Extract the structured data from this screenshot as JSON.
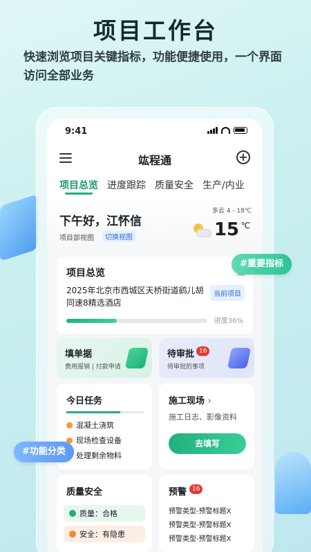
{
  "promo": {
    "title": "项目工作台",
    "subtitle": "快速浏览项目关键指标，功能便捷使用，一个界面访问全部业务"
  },
  "status_bar": {
    "time": "9:41"
  },
  "header": {
    "title": "竑程通"
  },
  "tabs": [
    {
      "label": "项目总览",
      "active": true
    },
    {
      "label": "进度跟踪",
      "active": false
    },
    {
      "label": "质量安全",
      "active": false
    },
    {
      "label": "生产/内业",
      "active": false
    }
  ],
  "greeting": {
    "text": "下午好，江怀信",
    "project_view": "项目部视图",
    "switch_view": "切换视图",
    "weather_desc": "多云 4 - 18℃",
    "temperature": "15",
    "unit": "℃"
  },
  "overview": {
    "title": "项目总览",
    "more": "更",
    "project_name": "2025年北京市西城区天桥街道鹞儿胡同速8精选酒店",
    "badge": "当前项目",
    "progress_label": "进度36%",
    "progress": 0.36
  },
  "quick": {
    "fill": {
      "title": "填单据",
      "subtitle": "费用报销 | 付款申请"
    },
    "approve": {
      "title": "待审批",
      "badge": "16",
      "subtitle": "待审批的事项"
    }
  },
  "tasks": {
    "title": "今日任务",
    "items": [
      "混凝土浇筑",
      "现场检查设备",
      "处理剩余物料"
    ]
  },
  "site": {
    "title": "施工现场",
    "chevron": "›",
    "subtitle": "施工日志、影像资料",
    "button": "去填写"
  },
  "quality": {
    "title": "质量安全",
    "rows": [
      "质量：合格",
      "安全：有隐患"
    ]
  },
  "warning": {
    "title": "预警",
    "badge": "16",
    "items": [
      "预警类型-预警标题X",
      "预警类型-预警标题X",
      "预警类型-预警标题X"
    ]
  },
  "tags": {
    "key_metrics": "#重要指标",
    "func_category": "#功能分类"
  },
  "colors": {
    "accent": "#1fb07c",
    "blue": "#2b6fd6",
    "danger": "#e53935"
  }
}
